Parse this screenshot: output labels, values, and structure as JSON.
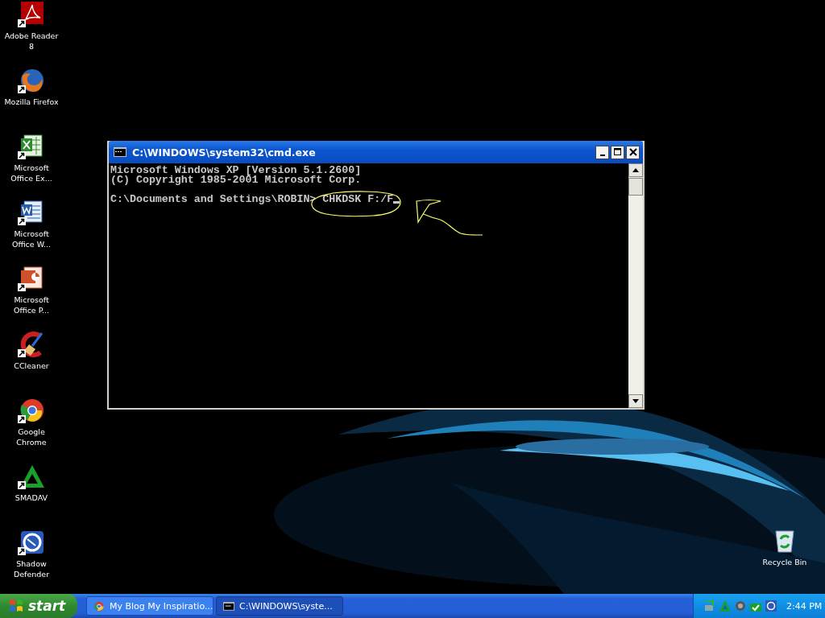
{
  "desktop_icons": [
    {
      "label": "Adobe Reader 8",
      "kind": "pdf"
    },
    {
      "label": "Mozilla Firefox",
      "kind": "firefox"
    },
    {
      "label": "Microsoft Office Ex...",
      "kind": "excel"
    },
    {
      "label": "Microsoft Office W...",
      "kind": "word"
    },
    {
      "label": "Microsoft Office P...",
      "kind": "powerpoint"
    },
    {
      "label": "CCleaner",
      "kind": "ccleaner"
    },
    {
      "label": "Google Chrome",
      "kind": "chrome"
    },
    {
      "label": "SMADAV",
      "kind": "smadav"
    },
    {
      "label": "Shadow Defender",
      "kind": "shield"
    }
  ],
  "recycle_bin": {
    "label": "Recycle Bin"
  },
  "window": {
    "title": "C:\\WINDOWS\\system32\\cmd.exe",
    "lines": [
      "Microsoft Windows XP [Version 5.1.2600]",
      "(C) Copyright 1985-2001 Microsoft Corp."
    ],
    "prompt": "C:\\Documents and Settings\\ROBIN>",
    "command": "CHKDSK F:/F"
  },
  "taskbar": {
    "start": "start",
    "tasks": [
      {
        "label": "My Blog My Inspiratio...",
        "kind": "chrome",
        "selected": false
      },
      {
        "label": "C:\\WINDOWS\\syste...",
        "kind": "console",
        "selected": true
      }
    ],
    "clock": "2:44 PM"
  }
}
